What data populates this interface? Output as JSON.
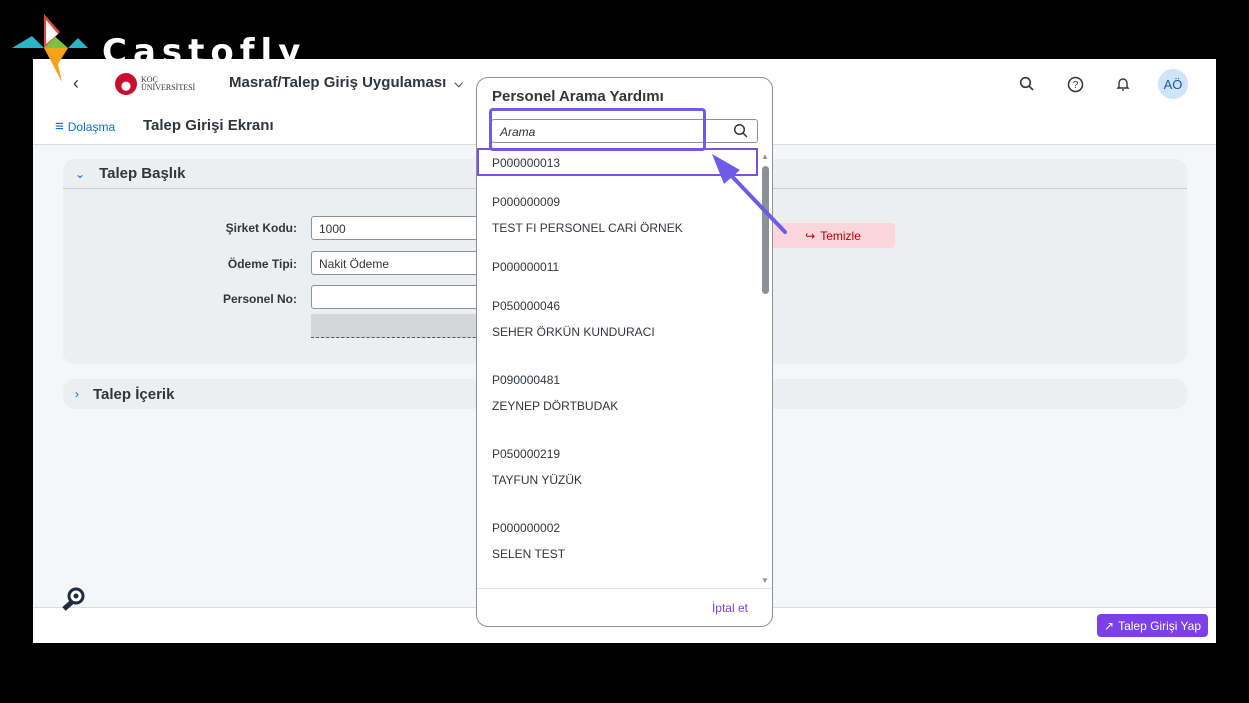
{
  "watermark": {
    "text": "Castofly"
  },
  "shell": {
    "logo_line1": "KOÇ",
    "logo_line2": "ÜNİVERSİTESİ",
    "app_title": "Masraf/Talep Giriş Uygulaması",
    "avatar_initials": "AÖ"
  },
  "subheader": {
    "nav_label": "Dolaşma",
    "page_title": "Talep Girişi Ekranı"
  },
  "header_panel": {
    "title": "Talep Başlık",
    "company_code_label": "Şirket Kodu:",
    "company_code_value": "1000",
    "payment_type_label": "Ödeme Tipi:",
    "payment_type_value": "Nakit Ödeme",
    "personnel_no_label": "Personel No:",
    "personnel_no_value": "",
    "clear_button": "Temizle"
  },
  "content_panel": {
    "title": "Talep İçerik"
  },
  "footer": {
    "submit_button": "Talep Girişi Yap"
  },
  "dialog": {
    "title": "Personel Arama Yardımı",
    "search_placeholder": "Arama",
    "cancel_button": "İptal et",
    "items": [
      {
        "id": "P000000013",
        "name": ""
      },
      {
        "id": "P000000009",
        "name": "TEST FI PERSONEL CARİ ÖRNEK"
      },
      {
        "id": "P000000011",
        "name": ""
      },
      {
        "id": "P050000046",
        "name": "SEHER ÖRKÜN KUNDURACI"
      },
      {
        "id": "P090000481",
        "name": "ZEYNEP DÖRTBUDAK"
      },
      {
        "id": "P050000219",
        "name": "TAYFUN YÜZÜK"
      },
      {
        "id": "P000000002",
        "name": "SELEN TEST"
      }
    ]
  },
  "colors": {
    "accent": "#7b40e8",
    "link": "#0a6ed1",
    "highlight": "#6c5ce7"
  }
}
